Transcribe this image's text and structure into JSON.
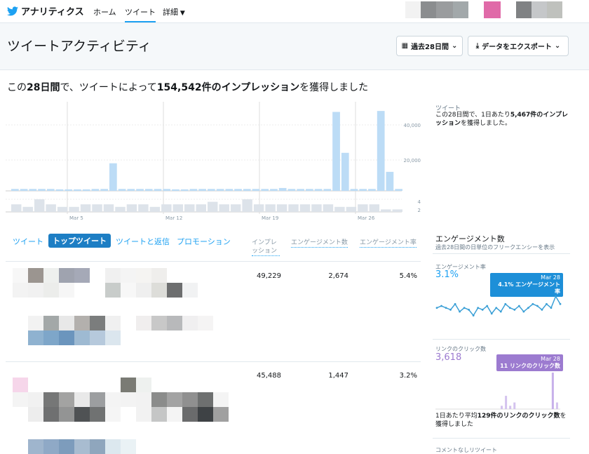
{
  "nav": {
    "brand": "アナリティクス",
    "home": "ホーム",
    "tweets": "ツイート",
    "more": "詳細"
  },
  "header": {
    "title": "ツイートアクティビティ",
    "period_button": "過去28日間",
    "export_button": "データをエクスポート"
  },
  "headline": {
    "prefix": "この",
    "days": "28日間",
    "middle": "で、ツイートによって",
    "count": "154,542件のインプレッション",
    "suffix": "を獲得しました"
  },
  "side_summary": {
    "title": "ツイート",
    "desc_prefix": "この28日間で、1日あたり",
    "desc_bold": "5,467件のインプレッション",
    "desc_suffix": "を獲得しました。"
  },
  "chart_data": {
    "type": "bar",
    "x_ticks": [
      "Mar 5",
      "Mar 12",
      "Mar 19",
      "Mar 26"
    ],
    "impressions": [
      1000,
      1000,
      1000,
      1000,
      1000,
      800,
      800,
      800,
      800,
      1000,
      1000,
      14500,
      1000,
      1000,
      1000,
      1000,
      1000,
      1000,
      800,
      800,
      1000,
      1000,
      1000,
      1000,
      1000,
      1000,
      1000,
      1000,
      1000,
      1000,
      1500,
      1000,
      1000,
      1000,
      1000,
      1000,
      41500,
      20000,
      1000,
      1000,
      1000,
      42000,
      10000,
      1000
    ],
    "engagements": [
      3,
      2,
      5,
      3,
      2,
      2,
      3,
      3,
      3,
      2,
      3,
      3,
      2,
      3,
      3,
      3,
      3,
      4,
      3,
      3,
      5,
      3,
      3,
      3,
      3,
      3,
      3,
      3,
      2,
      2,
      3,
      3,
      1,
      1
    ],
    "impressions_axis_ticks": [
      "40,000",
      "20,000"
    ],
    "engagements_axis_ticks": [
      "4",
      "2"
    ]
  },
  "tabs": [
    "ツイート",
    "トップツイート",
    "ツイートと返信",
    "プロモーション"
  ],
  "columns": [
    "インプレッション",
    "エンゲージメント数",
    "エンゲージメント率"
  ],
  "rows": [
    {
      "impressions": "49,229",
      "engagements": "2,674",
      "rate": "5.4%"
    },
    {
      "impressions": "45,488",
      "engagements": "1,447",
      "rate": "3.2%"
    }
  ],
  "right_panel": {
    "title": "エンゲージメント数",
    "subtitle": "過去28日間の日単位のフリークエンシーを表示",
    "rate_label": "エンゲージメント率",
    "rate_value": "3.1%",
    "rate_badge_date": "Mar 28",
    "rate_badge_text": "4.1% エンゲージメント率",
    "link_label": "リンクのクリック数",
    "link_value": "3,618",
    "link_badge_date": "Mar 28",
    "link_badge_text": "11 リンクのクリック数",
    "link_foot_prefix": "1日あたり平均",
    "link_foot_bold": "129件のリンクのクリック数",
    "link_foot_suffix": "を獲得しました",
    "last_label": "コメントなしリツイート",
    "rate_series": [
      3.0,
      3.1,
      3.0,
      2.9,
      3.2,
      2.8,
      3.0,
      2.9,
      2.6,
      3.0,
      2.9,
      3.1,
      2.7,
      3.0,
      2.8,
      3.2,
      3.0,
      2.9,
      3.1,
      2.8,
      3.0,
      3.2,
      3.1,
      2.9,
      3.2,
      3.0,
      3.6,
      3.2
    ],
    "link_series": [
      0,
      0,
      0,
      0,
      0,
      0,
      0,
      0,
      0,
      0,
      0,
      0,
      0,
      0,
      0,
      1,
      4,
      1,
      2,
      0,
      0,
      0,
      0,
      0,
      0,
      0,
      0,
      11,
      2
    ],
    "accent": "#1da1f2",
    "link_color": "#9c7bd0"
  }
}
